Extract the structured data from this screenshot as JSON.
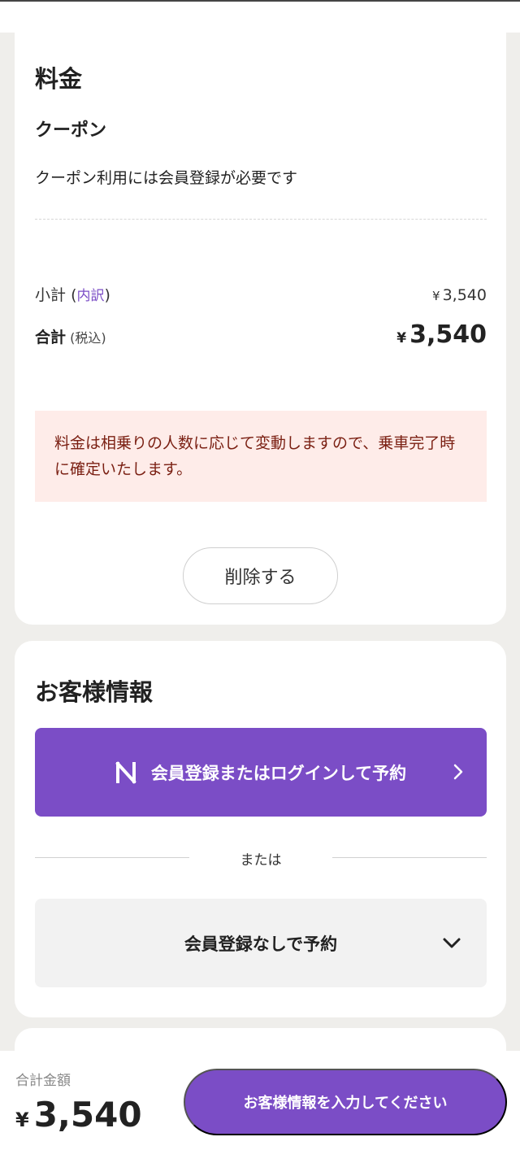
{
  "fee_section": {
    "title": "料金",
    "coupon_title": "クーポン",
    "coupon_note": "クーポン利用には会員登録が必要です",
    "subtotal_label": "小計",
    "breakdown_link": "内訳",
    "subtotal_currency": "¥",
    "subtotal_amount": "3,540",
    "total_label": "合計",
    "tax_note": "(税込)",
    "total_currency": "¥",
    "total_amount": "3,540",
    "alert_text": "料金は相乗りの人数に応じて変動しますので、乗車完了時に確定いたします。",
    "delete_label": "削除する"
  },
  "customer_section": {
    "title": "お客様情報",
    "login_button": "会員登録またはログインして予約",
    "or_text": "または",
    "guest_button": "会員登録なしで予約"
  },
  "footer": {
    "total_caption": "合計金額",
    "currency": "¥",
    "amount": "3,540",
    "cta_label": "お客様情報を入力してください"
  },
  "colors": {
    "accent": "#7b4dc6",
    "alert_bg": "#feece9",
    "alert_text": "#7a1f12"
  },
  "icons": {
    "login_logo": "n-logo-icon",
    "login_chevron": "chevron-right-icon",
    "guest_chevron": "chevron-down-icon"
  }
}
